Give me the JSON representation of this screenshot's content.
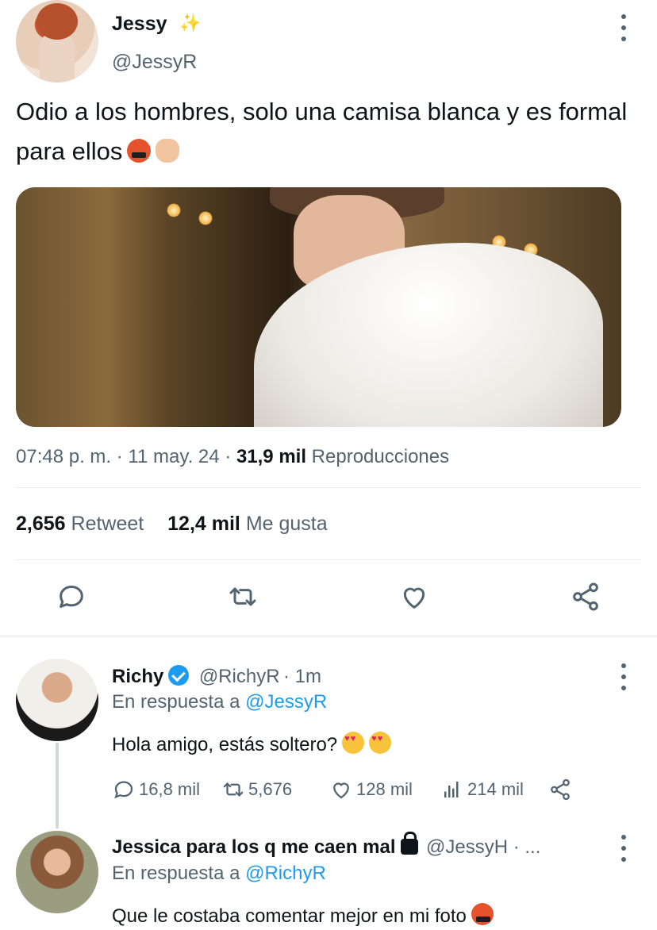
{
  "main_tweet": {
    "author_name": "Jessy",
    "author_badge": "✨",
    "author_handle": "@JessyR",
    "text": "Odio a los hombres, solo una camisa blanca y es formal para ellos",
    "emojis": [
      "face-with-symbols-on-mouth",
      "oncoming-fist"
    ],
    "meta": {
      "time": "07:48 p. m.",
      "date": "11 may. 24",
      "views_count": "31,9 mil",
      "views_label": "Reproducciones",
      "separator": "·"
    },
    "stats": {
      "retweets_count": "2,656",
      "retweets_label": "Retweet",
      "likes_count": "12,4 mil",
      "likes_label": "Me gusta"
    },
    "actions": [
      "reply-icon",
      "retweet-icon",
      "like-icon",
      "share-icon"
    ]
  },
  "replies": [
    {
      "author_name": "Richy",
      "verified": true,
      "author_handle": "@RichyR",
      "time": "· 1m",
      "in_reply_prefix": "En respuesta a",
      "in_reply_to": "@JessyR",
      "text": "Hola amigo, estás soltero?",
      "emojis": [
        "heart-eyes",
        "heart-eyes"
      ],
      "stats": {
        "replies": "16,8 mil",
        "retweets": "5,676",
        "likes": "128 mil",
        "views": "214 mil"
      }
    },
    {
      "author_name": "Jessica para los q me caen mal",
      "locked": true,
      "author_handle": "@JessyH · ...",
      "in_reply_prefix": "En respuesta a",
      "in_reply_to": "@RichyR",
      "text": "Que le costaba comentar mejor en mi foto",
      "emojis": [
        "face-with-symbols-on-mouth"
      ]
    }
  ],
  "colors": {
    "link": "#1d9bf0",
    "muted": "#536471",
    "text": "#0f1419",
    "divider": "#e6ecf0"
  }
}
